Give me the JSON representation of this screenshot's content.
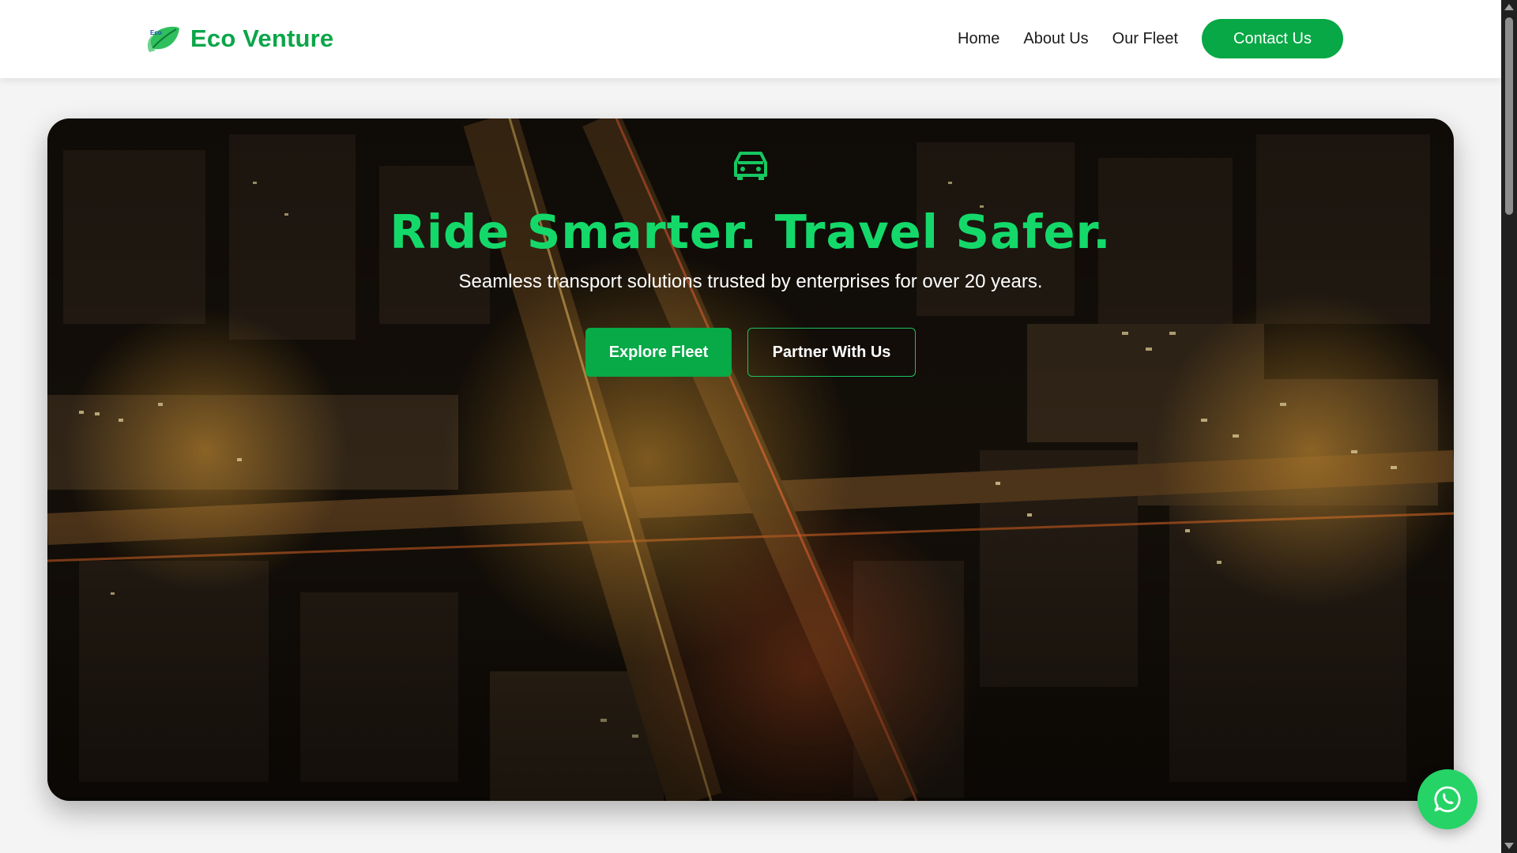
{
  "brand": {
    "name": "Eco Venture",
    "logo_text": "Eco",
    "logo_icon": "leaf-icon"
  },
  "nav": {
    "links": [
      "Home",
      "About Us",
      "Our Fleet"
    ],
    "cta": "Contact Us"
  },
  "hero": {
    "icon": "car-icon",
    "title": "Ride Smarter. Travel Safer.",
    "subtitle": "Seamless transport solutions trusted by enterprises for over 20 years.",
    "primary_button": "Explore Fleet",
    "secondary_button": "Partner With Us",
    "background": "night-city-aerial"
  },
  "fab": {
    "icon": "whatsapp-icon"
  },
  "colors": {
    "brand_green": "#0aa649",
    "title_green": "#14d96a",
    "button_green": "#08a947",
    "whatsapp_green": "#25d366"
  }
}
